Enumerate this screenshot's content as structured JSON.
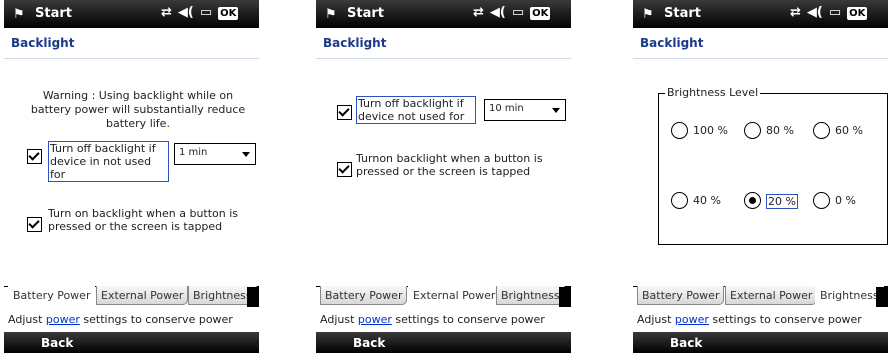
{
  "common": {
    "start": "Start",
    "ok": "OK",
    "title": "Backlight",
    "back": "Back",
    "footer_pre": "Adjust ",
    "footer_link": "power",
    "footer_post": " settings to conserve power",
    "tabs": [
      "Battery Power",
      "External Power",
      "Brightness"
    ]
  },
  "screen1": {
    "warning": "Warning : Using backlight while on battery power will substantially reduce battery life.",
    "cb1_label": "Turn off backlight if device in not used for",
    "dropdown_value": "1 min",
    "cb2_label": "Turn on backlight when a button is pressed or the screen is tapped"
  },
  "screen2": {
    "cb1_label": "Turn off backlight if device not used for",
    "dropdown_value": "10 min",
    "cb2_label": "Turnon backlight when a button is pressed or the screen is tapped"
  },
  "screen3": {
    "group_title": "Brightness Level",
    "options": [
      "100 %",
      "80 %",
      "60 %",
      "40 %",
      "20 %",
      "0 %"
    ],
    "selected": "20 %"
  }
}
